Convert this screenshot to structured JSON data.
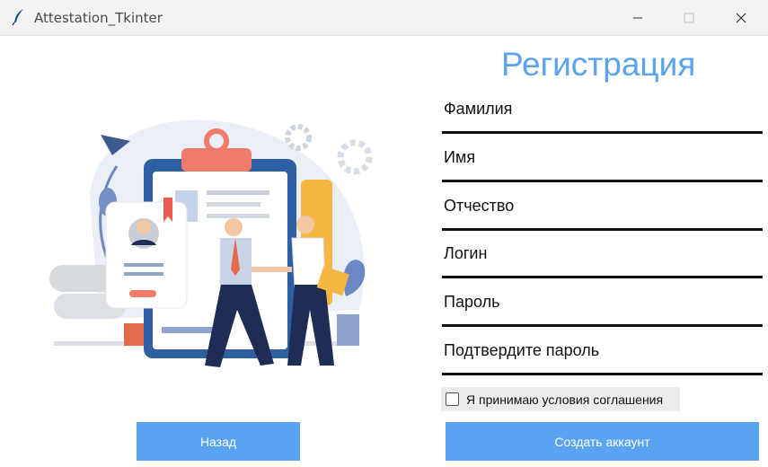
{
  "window": {
    "title": "Attestation_Tkinter"
  },
  "form": {
    "heading": "Регистрация",
    "fields": [
      {
        "label": "Фамилия"
      },
      {
        "label": "Имя"
      },
      {
        "label": "Отчество"
      },
      {
        "label": "Логин"
      },
      {
        "label": "Пароль"
      },
      {
        "label": "Подтвердите пароль"
      }
    ],
    "agree_label": "Я принимаю условия соглашения",
    "agree_checked": false,
    "back_button": "Назад",
    "create_button": "Создать аккаунт"
  },
  "colors": {
    "accent": "#5aa3f0",
    "titlebar": "#f3f3f3",
    "line": "#111111",
    "checkbox_bg": "#ececec"
  },
  "icons": [
    "feather-icon",
    "minimize-icon",
    "maximize-icon",
    "close-icon",
    "illustration-registration"
  ]
}
